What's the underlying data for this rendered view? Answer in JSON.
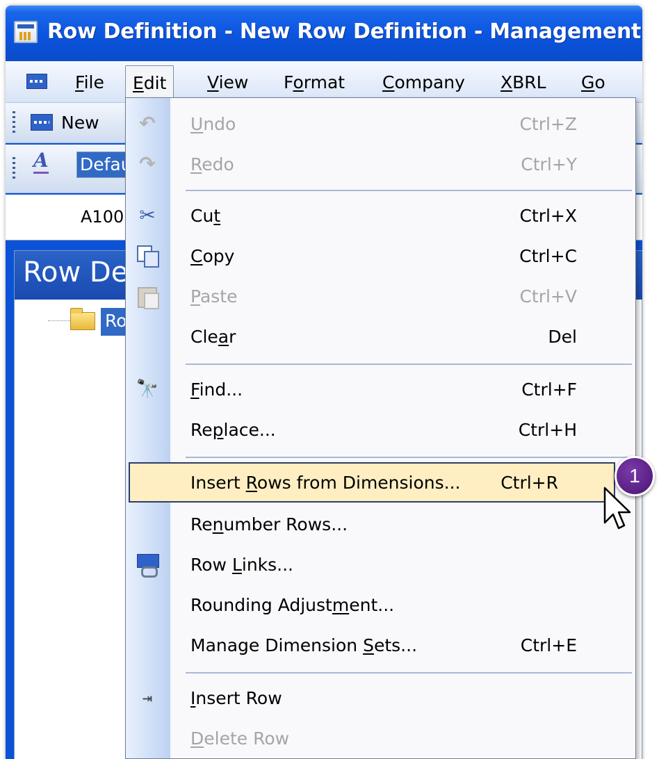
{
  "window": {
    "title": "Row Definition - New Row Definition - Management I"
  },
  "menubar": {
    "items": [
      {
        "pre": "",
        "key": "F",
        "post": "ile"
      },
      {
        "pre": "",
        "key": "E",
        "post": "dit"
      },
      {
        "pre": "",
        "key": "V",
        "post": "iew"
      },
      {
        "pre": "F",
        "key": "o",
        "post": "rmat"
      },
      {
        "pre": "",
        "key": "C",
        "post": "ompany"
      },
      {
        "pre": "",
        "key": "X",
        "post": "BRL"
      },
      {
        "pre": "",
        "key": "G",
        "post": "o"
      }
    ]
  },
  "toolbar": {
    "new_label": "New",
    "style_icon": "A",
    "style_value": "Defau"
  },
  "grid": {
    "cell_ref": "A100"
  },
  "pane": {
    "title": "Row De",
    "tree_label": "Ro"
  },
  "edit_menu": {
    "items": [
      {
        "pre": "",
        "key": "U",
        "post": "ndo",
        "shortcut": "Ctrl+Z",
        "enabled": false,
        "icon": "undo-icon"
      },
      {
        "pre": "",
        "key": "R",
        "post": "edo",
        "shortcut": "Ctrl+Y",
        "enabled": false,
        "icon": "redo-icon"
      },
      {
        "pre": "Cu",
        "key": "t",
        "post": "",
        "shortcut": "Ctrl+X",
        "enabled": true,
        "icon": "scissors-icon"
      },
      {
        "pre": "",
        "key": "C",
        "post": "opy",
        "shortcut": "Ctrl+C",
        "enabled": true,
        "icon": "copy-icon"
      },
      {
        "pre": "",
        "key": "P",
        "post": "aste",
        "shortcut": "Ctrl+V",
        "enabled": false,
        "icon": "paste-icon"
      },
      {
        "pre": "Cle",
        "key": "a",
        "post": "r",
        "shortcut": "Del",
        "enabled": true,
        "icon": ""
      },
      {
        "pre": "",
        "key": "F",
        "post": "ind...",
        "shortcut": "Ctrl+F",
        "enabled": true,
        "icon": "binoculars-icon"
      },
      {
        "pre": "Re",
        "key": "p",
        "post": "lace...",
        "shortcut": "Ctrl+H",
        "enabled": true,
        "icon": ""
      },
      {
        "pre": "Insert ",
        "key": "R",
        "post": "ows from Dimensions...",
        "shortcut": "Ctrl+R",
        "enabled": true,
        "icon": "",
        "highlighted": true
      },
      {
        "pre": "Re",
        "key": "n",
        "post": "umber Rows...",
        "shortcut": "",
        "enabled": true,
        "icon": ""
      },
      {
        "pre": "Row ",
        "key": "L",
        "post": "inks...",
        "shortcut": "",
        "enabled": true,
        "icon": "row-links-icon"
      },
      {
        "pre": "Rounding Adjust",
        "key": "m",
        "post": "ent...",
        "shortcut": "",
        "enabled": true,
        "icon": ""
      },
      {
        "pre": "Manage Dimension ",
        "key": "S",
        "post": "ets...",
        "shortcut": "Ctrl+E",
        "enabled": true,
        "icon": ""
      },
      {
        "pre": "",
        "key": "I",
        "post": "nsert Row",
        "shortcut": "",
        "enabled": true,
        "icon": "insert-row-icon"
      },
      {
        "pre": "",
        "key": "D",
        "post": "elete Row",
        "shortcut": "",
        "enabled": false,
        "icon": ""
      }
    ]
  },
  "callout": {
    "number": "1",
    "color": "#5a1f86"
  },
  "colors": {
    "title_bar": "#0b54de",
    "selection": "#316ac5",
    "menu_highlight": "#ffeec2"
  }
}
